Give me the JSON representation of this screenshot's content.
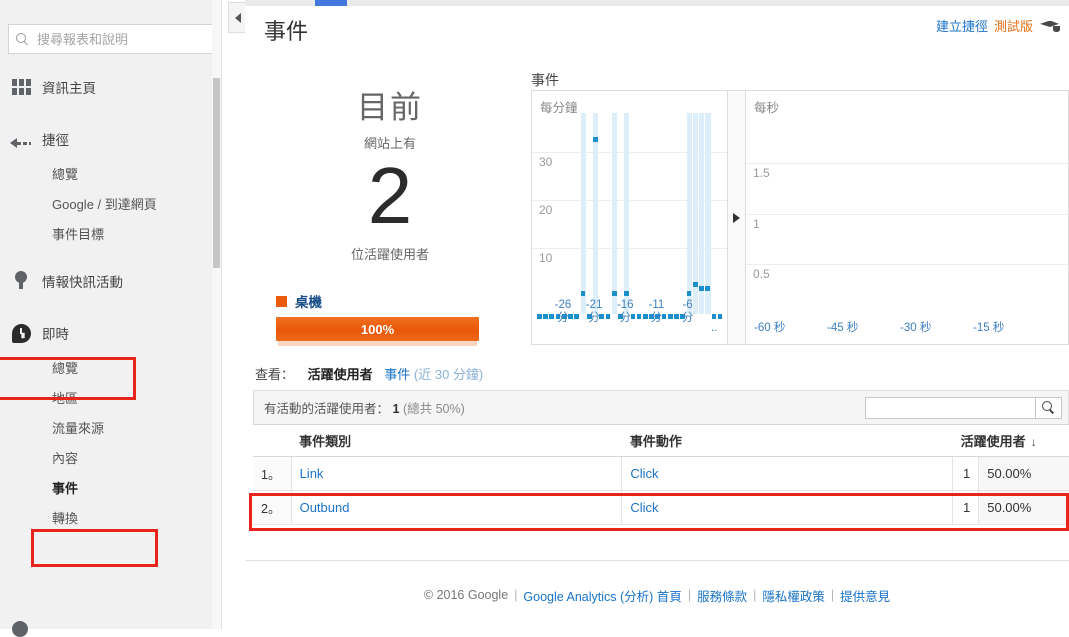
{
  "sidebar": {
    "search": {
      "placeholder": "搜尋報表和說明",
      "value": ""
    },
    "groups": [
      {
        "icon": "grid-icon",
        "label": "資訊主頁",
        "children": []
      },
      {
        "icon": "shortcut-arrow-icon",
        "label": "捷徑",
        "children": [
          "總覽",
          "Google / 到達網頁",
          "事件目標"
        ]
      },
      {
        "icon": "bulb-icon",
        "label": "情報快訊活動",
        "children": []
      },
      {
        "icon": "clock-icon",
        "label": "即時",
        "children": [
          "總覽",
          "地區",
          "流量來源",
          "內容",
          "事件",
          "轉換"
        ]
      }
    ],
    "highlighted_items": [
      "即時",
      "事件"
    ],
    "active_child": "事件"
  },
  "header": {
    "title": "事件",
    "shortcut_label": "建立捷徑",
    "beta_label": "測試版",
    "cap_icon": "graduation-cap-icon"
  },
  "counter": {
    "now_label": "目前",
    "sub_label_1": "網站上有",
    "value": "2",
    "sub_label_2": "位活躍使用者",
    "device_legend": "桌機",
    "device_percent": "100%",
    "device_color": "#ea5b0c"
  },
  "charts_title": "事件",
  "chart_data": [
    {
      "type": "bar",
      "title": "每分鐘",
      "xlabel": "",
      "ylabel": "",
      "ylim": [
        0,
        38
      ],
      "yticks": [
        10,
        20,
        30
      ],
      "xticks": [
        "-26 分",
        "-21 分",
        "-16 分",
        "-11 分",
        "-6 分"
      ],
      "grid": true,
      "categories": [
        "-30",
        "-29",
        "-28",
        "-27",
        "-26",
        "-25",
        "-24",
        "-23",
        "-22",
        "-21",
        "-20",
        "-19",
        "-18",
        "-17",
        "-16",
        "-15",
        "-14",
        "-13",
        "-12",
        "-11",
        "-10",
        "-9",
        "-8",
        "-7",
        "-6",
        "-5",
        "-4",
        "-3",
        "-2",
        "-1"
      ],
      "values": [
        0,
        0,
        0,
        0,
        0,
        0,
        0,
        1,
        0,
        33,
        0,
        0,
        1,
        0,
        1,
        0,
        0,
        0,
        0,
        0,
        0,
        0,
        0,
        0,
        1,
        3,
        2,
        2,
        0,
        0
      ],
      "bar_color": "#1a8fce",
      "highlight_color": "#dbeefa"
    },
    {
      "type": "bar",
      "title": "每秒",
      "xlabel": "",
      "ylabel": "",
      "ylim": [
        0,
        2
      ],
      "yticks": [
        0.5,
        1,
        1.5
      ],
      "xticks": [
        "-60 秒",
        "-45 秒",
        "-30 秒",
        "-15 秒"
      ],
      "grid": true,
      "categories": [],
      "values": [],
      "bar_color": "#1a8fce"
    }
  ],
  "viewby": {
    "label": "查看：",
    "option_active": "活躍使用者",
    "option_link": "事件",
    "option_link_sub": "(近 30 分鐘)"
  },
  "table": {
    "active_users_prefix": "有活動的活躍使用者：",
    "active_users_count": "1",
    "active_users_total": "(總共 50%)",
    "search_placeholder": "",
    "search_value": "",
    "columns": [
      "事件類別",
      "事件動作",
      "活躍使用者"
    ],
    "sort_indicator": "↓",
    "rows": [
      {
        "index": "1。",
        "category": "Link",
        "action": "Click",
        "users": "1",
        "percent": "50.00%"
      },
      {
        "index": "2。",
        "category": "Outbund",
        "action": "Click",
        "users": "1",
        "percent": "50.00%"
      }
    ],
    "highlighted_row_index": 1
  },
  "footer": {
    "copyright": "© 2016 Google",
    "links": [
      "Google Analytics (分析) 首頁",
      "服務條款",
      "隱私權政策",
      "提供意見"
    ]
  },
  "annotation_color": "#e8251c"
}
